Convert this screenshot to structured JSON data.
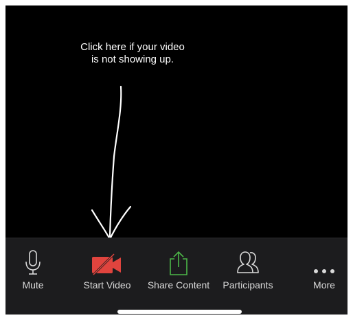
{
  "annotation": {
    "line1": "Click here if your video",
    "line2": "is not showing up."
  },
  "toolbar": {
    "items": [
      {
        "label": "Mute",
        "icon": "microphone-icon"
      },
      {
        "label": "Start Video",
        "icon": "video-off-icon"
      },
      {
        "label": "Share Content",
        "icon": "share-icon"
      },
      {
        "label": "Participants",
        "icon": "participants-icon"
      },
      {
        "label": "More",
        "icon": "more-icon"
      }
    ]
  },
  "colors": {
    "background": "#000000",
    "toolbar": "#1c1c1e",
    "video_off_red": "#e0443e",
    "share_green": "#4cb648",
    "label_gray": "#d9d9d9"
  }
}
